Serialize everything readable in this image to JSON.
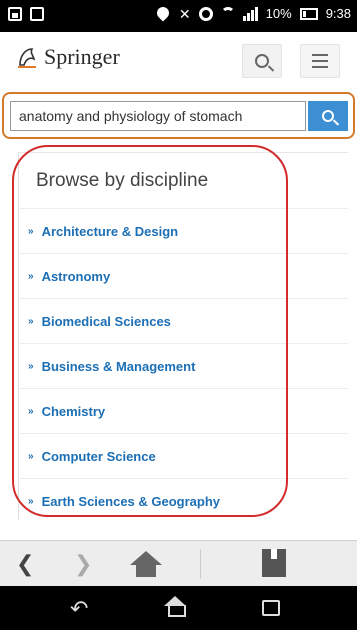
{
  "status_bar": {
    "battery_percent": "10%",
    "time": "9:38"
  },
  "header": {
    "logo_text": "Springer"
  },
  "search": {
    "value": "anatomy and physiology of stomach"
  },
  "browse": {
    "title": "Browse by discipline",
    "items": [
      "Architecture & Design",
      "Astronomy",
      "Biomedical Sciences",
      "Business & Management",
      "Chemistry",
      "Computer Science",
      "Earth Sciences & Geography"
    ]
  },
  "colors": {
    "link": "#1c6fb5",
    "search_button": "#3d8fd4",
    "highlight_red": "#d32a2a",
    "highlight_orange": "#d47a2c"
  }
}
